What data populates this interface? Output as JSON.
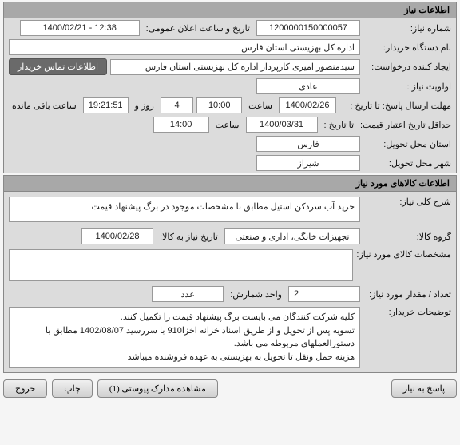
{
  "section1": {
    "title": "اطلاعات نیاز",
    "req_number_label": "شماره نیاز:",
    "req_number": "1200000150000057",
    "public_datetime_label": "تاریخ و ساعت اعلان عمومی:",
    "public_datetime": "1400/02/21 - 12:38",
    "buyer_org_label": "نام دستگاه خریدار:",
    "buyer_org": "اداره کل بهزیستی استان فارس",
    "creator_label": "ایجاد کننده درخواست:",
    "creator": "سیدمنصور امیری کارپرداز اداره کل بهزیستی استان فارس",
    "contact_button": "اطلاعات تماس خریدار",
    "priority_label": "اولویت نیاز :",
    "priority": "عادی",
    "deadline_label": "مهلت ارسال پاسخ:  تا تاریخ :",
    "deadline_date": "1400/02/26",
    "time_label": "ساعت",
    "deadline_time": "10:00",
    "remaining_days": "4",
    "days_and_label": "روز و",
    "remaining_time": "19:21:51",
    "remaining_suffix": "ساعت باقی مانده",
    "min_validity_label": "حداقل تاریخ اعتبار قیمت:",
    "to_date_label": "تا تاریخ :",
    "min_validity_date": "1400/03/31",
    "min_validity_time": "14:00",
    "province_label": "استان محل تحویل:",
    "province": "فارس",
    "city_label": "شهر محل تحویل:",
    "city": "شیراز"
  },
  "section2": {
    "title": "اطلاعات کالاهای مورد نیاز",
    "desc_label": "شرح کلی نیاز:",
    "desc": "خرید آب سردکن استیل مطابق با مشخصات موجود در برگ پیشنهاد قیمت",
    "group_label": "گروه کالا:",
    "group": "تجهیزات خانگی، اداری و صنعتی",
    "need_date_label": "تاریخ نیاز به کالا:",
    "need_date": "1400/02/28",
    "specs_label": "مشخصات کالای مورد نیاز:",
    "specs": "",
    "qty_label": "تعداد / مقدار مورد نیاز:",
    "qty": "2",
    "unit_label": "واحد شمارش:",
    "unit": "عدد",
    "buyer_notes_label": "توضیحات خریدار:",
    "buyer_notes": "کلیه شرکت کنندگان می بایست برگ پیشنهاد قیمت را تکمیل کنند.\nتسویه پس از تحویل و از طریق اسناد خزانه اخزا910 با سررسید 1402/08/07 مطابق با دستورالعملهای مربوطه می باشد.\nهزینه حمل ونقل تا تحویل به بهزیستی به عهده فروشنده میباشد"
  },
  "buttons": {
    "respond": "پاسخ به نیاز",
    "view_attachments": "مشاهده مدارک پیوستی (1)",
    "print": "چاپ",
    "exit": "خروج"
  }
}
